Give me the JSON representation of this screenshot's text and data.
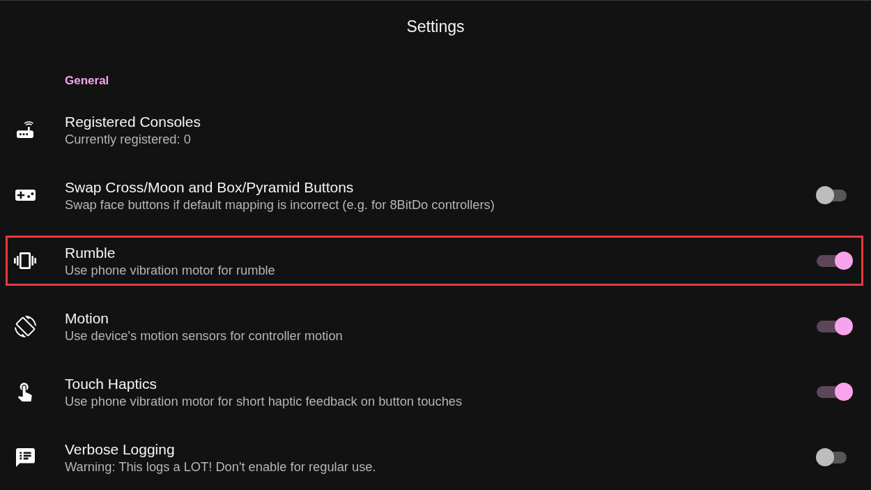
{
  "app_bar": {
    "title": "Settings"
  },
  "sections": [
    {
      "header": "General",
      "items": [
        {
          "kind": "info",
          "title": "Registered Consoles",
          "summary": "Currently registered: 0",
          "highlighted": false
        },
        {
          "kind": "toggle",
          "title": "Swap Cross/Moon and Box/Pyramid Buttons",
          "summary": "Swap face buttons if default mapping is incorrect (e.g. for 8BitDo controllers)",
          "on": false,
          "highlighted": false
        },
        {
          "kind": "toggle",
          "title": "Rumble",
          "summary": "Use phone vibration motor for rumble",
          "on": true,
          "highlighted": true
        },
        {
          "kind": "toggle",
          "title": "Motion",
          "summary": "Use device's motion sensors for controller motion",
          "on": true,
          "highlighted": false
        },
        {
          "kind": "toggle",
          "title": "Touch Haptics",
          "summary": "Use phone vibration motor for short haptic feedback on button touches",
          "on": true,
          "highlighted": false
        },
        {
          "kind": "toggle",
          "title": "Verbose Logging",
          "summary": "Warning: This logs a LOT! Don't enable for regular use.",
          "on": false,
          "highlighted": false
        }
      ]
    }
  ]
}
